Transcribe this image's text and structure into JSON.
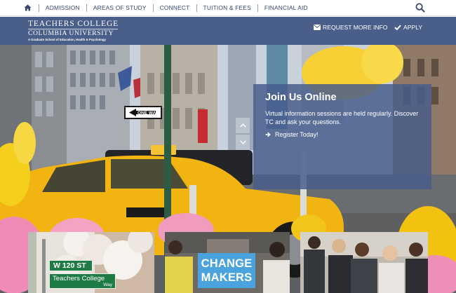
{
  "topnav": {
    "home_icon": "home-icon",
    "links": [
      "ADMISSION",
      "AREAS OF STUDY",
      "CONNECT",
      "TUITION & FEES",
      "FINANCIAL AID"
    ],
    "search_icon": "search-icon"
  },
  "header": {
    "logo": {
      "line1": "TEACHERS COLLEGE",
      "line2": "COLUMBIA UNIVERSITY",
      "line3": "A Graduate School of Education, Health & Psychology"
    },
    "request_info": {
      "label": "REQUEST MORE INFO",
      "icon": "envelope-icon"
    },
    "apply": {
      "label": "APPLY",
      "icon": "checkmark-icon"
    },
    "background_color": "#4a5e8a"
  },
  "hero": {
    "panel": {
      "title": "Join Us Online",
      "body": "Virtual information sessions are held regularly. Discover TC and ask your questions.",
      "link_label": "Register Today!",
      "link_icon": "arrow-right-icon",
      "background_color": "#475c8c"
    },
    "scroll_up_icon": "chevron-up-icon",
    "scroll_down_icon": "chevron-down-icon",
    "street_sign": "ONE WAY"
  },
  "cards": [
    {
      "name": "campus-street-sign",
      "sign_street": "W 120 ST",
      "sign_name": "Teachers College",
      "sign_sub": "Way"
    },
    {
      "name": "change-makers",
      "title_line1": "CHANGE",
      "title_line2": "MAKERS",
      "accent_color": "#4aa3dc"
    },
    {
      "name": "classroom-students"
    }
  ]
}
